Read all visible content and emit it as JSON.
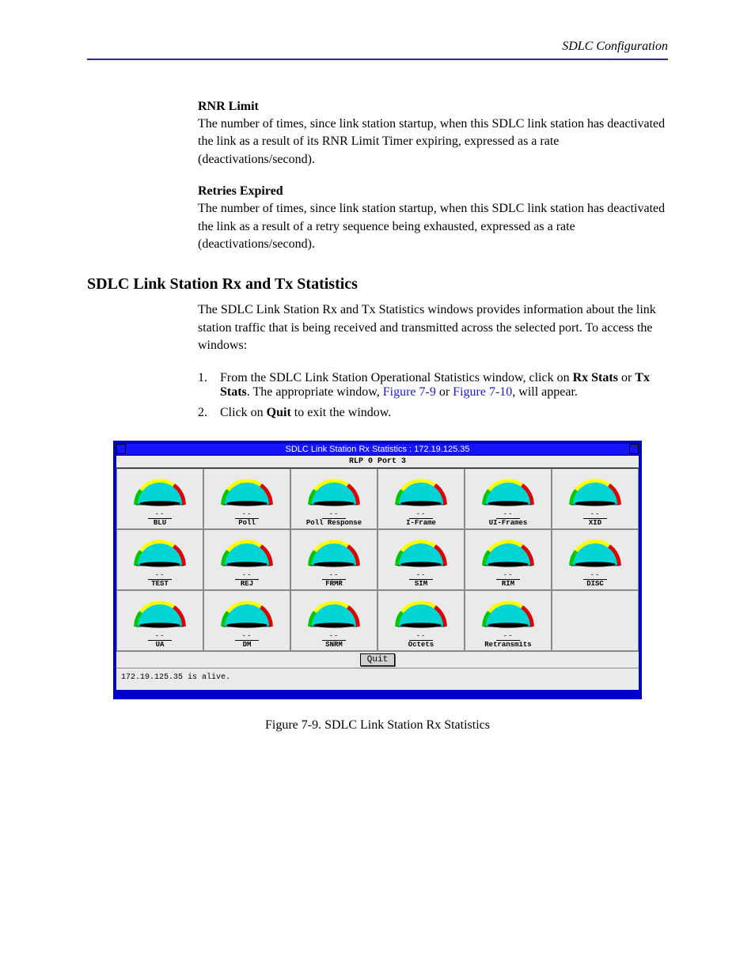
{
  "header_text": "SDLC Configuration",
  "section_rnr": {
    "heading": "RNR Limit",
    "body": "The number of times, since link station startup, when this SDLC link station has deactivated the link as a result of its RNR Limit Timer expiring, expressed as a rate (deactivations/second)."
  },
  "section_retries": {
    "heading": "Retries Expired",
    "body": "The number of times, since link station startup, when this SDLC link station has deactivated the link as a result of a retry sequence being exhausted, expressed as a rate (deactivations/second)."
  },
  "section_sdlc": {
    "heading": "SDLC Link Station Rx and Tx Statistics",
    "body": "The SDLC Link Station Rx and Tx Statistics windows provides information about the link station traffic that is being received and transmitted across the selected port. To access the windows:"
  },
  "steps": {
    "s1_num": "1.",
    "s1_pre": "From the SDLC Link Station Operational Statistics window, click on ",
    "s1_bold1": "Rx Stats",
    "s1_mid": " or ",
    "s1_bold2": "Tx Stats",
    "s1_end": ". The appropriate window, ",
    "s1_link1": "Figure 7-9",
    "s1_or": " or ",
    "s1_link2": "Figure 7-10",
    "s1_tail": ", will appear.",
    "s2_num": "2.",
    "s2_pre": "Click on ",
    "s2_bold": "Quit",
    "s2_end": " to exit the window."
  },
  "figure": {
    "title": "SDLC Link Station Rx Statistics : 172.19.125.35",
    "subtitle": "RLP 0 Port 3",
    "quit_label": "Quit",
    "status": "172.19.125.35 is alive.",
    "caption": "Figure 7-9. SDLC Link Station Rx Statistics",
    "gauges": [
      {
        "val": "--",
        "label": "BLU"
      },
      {
        "val": "--",
        "label": "Poll"
      },
      {
        "val": "--",
        "label": "Poll Response"
      },
      {
        "val": "--",
        "label": "I-Frame"
      },
      {
        "val": "--",
        "label": "UI-Frames"
      },
      {
        "val": "--",
        "label": "XID"
      },
      {
        "val": "--",
        "label": "TEST"
      },
      {
        "val": "--",
        "label": "REJ"
      },
      {
        "val": "--",
        "label": "FRMR"
      },
      {
        "val": "--",
        "label": "SIM"
      },
      {
        "val": "--",
        "label": "RIM"
      },
      {
        "val": "--",
        "label": "DISC"
      },
      {
        "val": "--",
        "label": "UA"
      },
      {
        "val": "--",
        "label": "DM"
      },
      {
        "val": "--",
        "label": "SNRM"
      },
      {
        "val": "--",
        "label": "Octets"
      },
      {
        "val": "--",
        "label": "Retransmits"
      }
    ]
  }
}
